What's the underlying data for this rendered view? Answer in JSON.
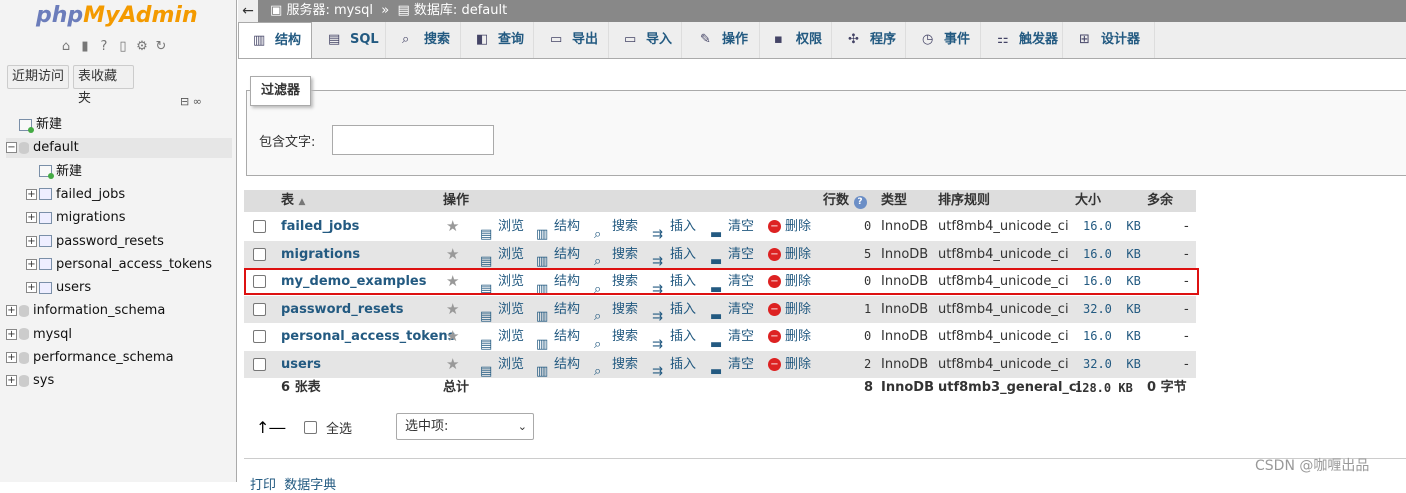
{
  "logo": {
    "php": "php",
    "myadmin": "MyAdmin"
  },
  "left": {
    "recent_btn": "近期访问",
    "fav_btn": "表收藏夹",
    "tree": [
      {
        "label": "新建",
        "level": 0,
        "kind": "new"
      },
      {
        "label": "default",
        "level": 0,
        "kind": "db",
        "expanded": true
      },
      {
        "label": "新建",
        "level": 1,
        "kind": "new"
      },
      {
        "label": "failed_jobs",
        "level": 1,
        "kind": "table"
      },
      {
        "label": "migrations",
        "level": 1,
        "kind": "table"
      },
      {
        "label": "password_resets",
        "level": 1,
        "kind": "table"
      },
      {
        "label": "personal_access_tokens",
        "level": 1,
        "kind": "table"
      },
      {
        "label": "users",
        "level": 1,
        "kind": "table"
      },
      {
        "label": "information_schema",
        "level": 0,
        "kind": "db"
      },
      {
        "label": "mysql",
        "level": 0,
        "kind": "db"
      },
      {
        "label": "performance_schema",
        "level": 0,
        "kind": "db"
      },
      {
        "label": "sys",
        "level": 0,
        "kind": "db"
      }
    ]
  },
  "breadcrumb": {
    "server_label": "服务器:",
    "server": "mysql",
    "sep": "»",
    "db_label": "数据库:",
    "db": "default"
  },
  "tabs": [
    {
      "label": "结构",
      "icon": "structure-icon",
      "active": true
    },
    {
      "label": "SQL",
      "icon": "sql-icon"
    },
    {
      "label": "搜索",
      "icon": "search-icon"
    },
    {
      "label": "查询",
      "icon": "query-icon"
    },
    {
      "label": "导出",
      "icon": "export-icon"
    },
    {
      "label": "导入",
      "icon": "import-icon"
    },
    {
      "label": "操作",
      "icon": "wrench-icon"
    },
    {
      "label": "权限",
      "icon": "privileges-icon"
    },
    {
      "label": "程序",
      "icon": "routines-icon"
    },
    {
      "label": "事件",
      "icon": "clock-icon"
    },
    {
      "label": "触发器",
      "icon": "triggers-icon"
    },
    {
      "label": "设计器",
      "icon": "designer-icon"
    }
  ],
  "filter": {
    "legend": "过滤器",
    "label": "包含文字:",
    "value": ""
  },
  "table": {
    "headers": {
      "table": "表",
      "action": "操作",
      "rows": "行数",
      "type": "类型",
      "collation": "排序规则",
      "size": "大小",
      "overhead": "多余"
    },
    "actions": {
      "browse": "浏览",
      "structure": "结构",
      "search": "搜索",
      "insert": "插入",
      "empty": "清空",
      "drop": "删除"
    },
    "rows": [
      {
        "name": "failed_jobs",
        "rows": "0",
        "type": "InnoDB",
        "collation": "utf8mb4_unicode_ci",
        "size": "16.0",
        "unit": "KB",
        "overhead": "-",
        "highlighted": false,
        "dim": false
      },
      {
        "name": "migrations",
        "rows": "5",
        "type": "InnoDB",
        "collation": "utf8mb4_unicode_ci",
        "size": "16.0",
        "unit": "KB",
        "overhead": "-",
        "highlighted": false,
        "dim": true
      },
      {
        "name": "my_demo_examples",
        "rows": "0",
        "type": "InnoDB",
        "collation": "utf8mb4_unicode_ci",
        "size": "16.0",
        "unit": "KB",
        "overhead": "-",
        "highlighted": true,
        "dim": true
      },
      {
        "name": "password_resets",
        "rows": "1",
        "type": "InnoDB",
        "collation": "utf8mb4_unicode_ci",
        "size": "32.0",
        "unit": "KB",
        "overhead": "-",
        "highlighted": false,
        "dim": true
      },
      {
        "name": "personal_access_tokens",
        "rows": "0",
        "type": "InnoDB",
        "collation": "utf8mb4_unicode_ci",
        "size": "16.0",
        "unit": "KB",
        "overhead": "-",
        "highlighted": false,
        "dim": true
      },
      {
        "name": "users",
        "rows": "2",
        "type": "InnoDB",
        "collation": "utf8mb4_unicode_ci",
        "size": "32.0",
        "unit": "KB",
        "overhead": "-",
        "highlighted": false,
        "dim": true
      }
    ],
    "footer": {
      "count": "6 张表",
      "label": "总计",
      "rows": "8",
      "type": "InnoDB",
      "collation": "utf8mb3_general_ci",
      "size": "128.0",
      "unit": "KB",
      "overhead": "0 字节"
    }
  },
  "bulk": {
    "check_all": "全选",
    "select_label": "选中项:"
  },
  "print": {
    "print": "打印",
    "dict": "数据字典"
  },
  "watermark": "CSDN @咖喱出品",
  "colors": {
    "link": "#235a81",
    "highlight_border": "#d11111",
    "header_bg": "#dddddd",
    "row_alt": "#e5e5e5"
  }
}
